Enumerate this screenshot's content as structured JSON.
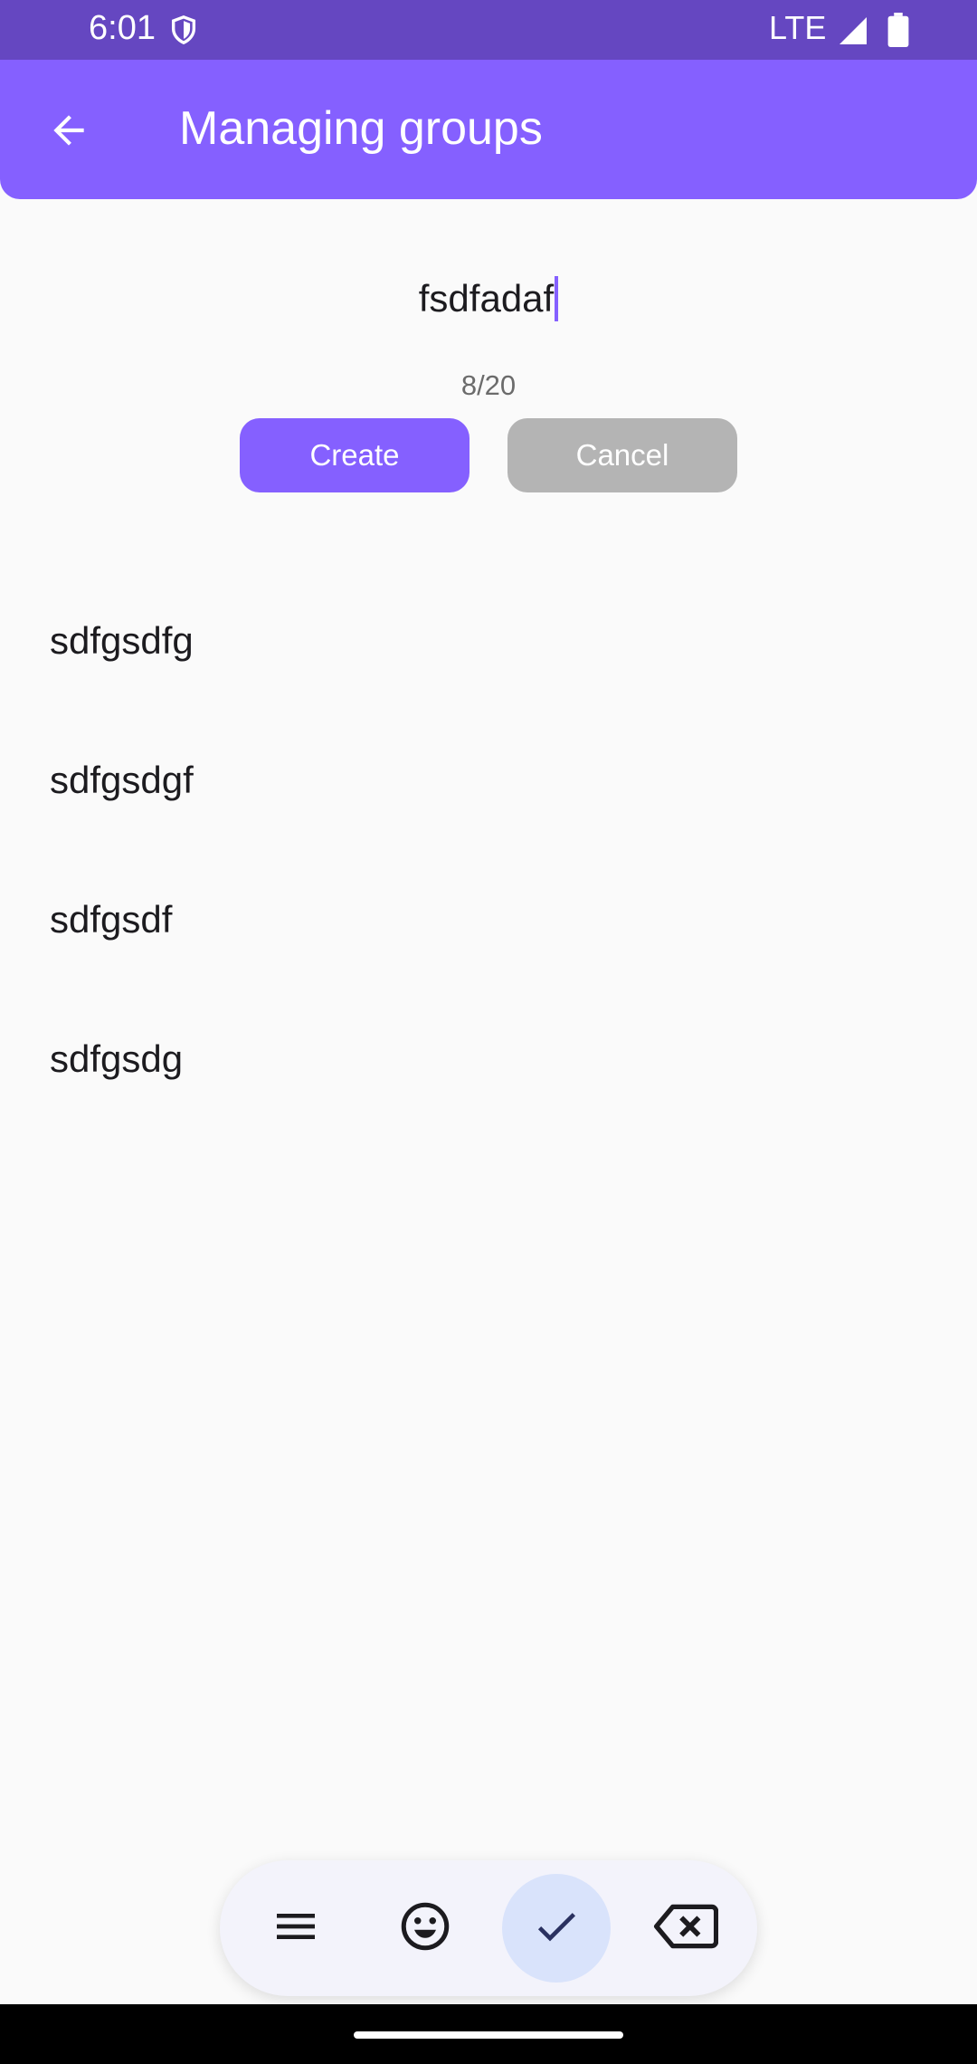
{
  "status_bar": {
    "time": "6:01",
    "network": "LTE"
  },
  "app_bar": {
    "title": "Managing groups"
  },
  "group_form": {
    "name_value": "fsdfadaf",
    "char_counter": "8/20",
    "create_label": "Create",
    "cancel_label": "Cancel"
  },
  "groups": [
    "sdfgsdfg",
    "sdfgsdgf",
    "sdfgsdf",
    "sdfgsdg"
  ],
  "keyboard_toolbar": {
    "icons": [
      "menu-icon",
      "emoji-icon",
      "check-icon",
      "backspace-icon"
    ]
  },
  "colors": {
    "status_bar": "#6547c1",
    "app_bar": "#8560ff",
    "accent": "#8560ff",
    "cancel_button": "#b4b4b4",
    "background": "#fafafa"
  }
}
